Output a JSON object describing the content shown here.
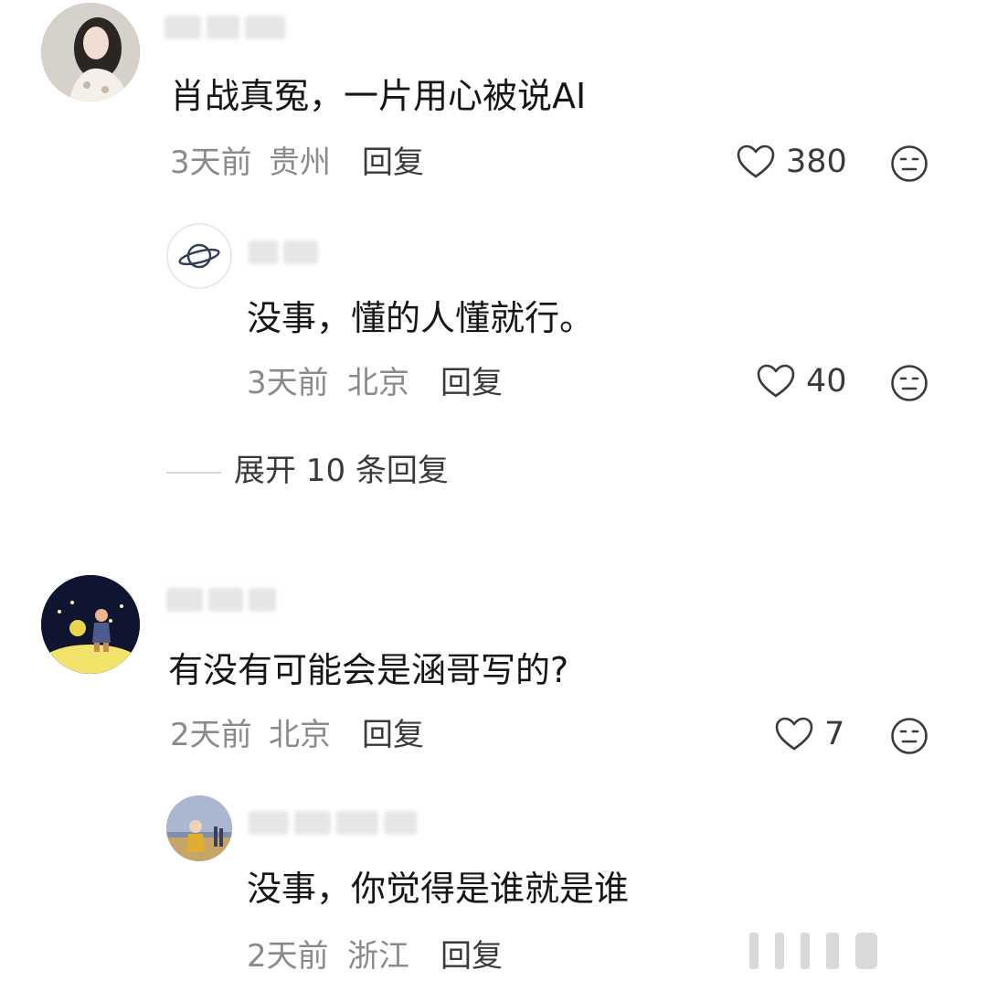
{
  "comments": [
    {
      "text": "肖战真冤，一片用心被说AI",
      "time": "3天前",
      "location": "贵州",
      "reply_label": "回复",
      "likes": "380",
      "reply": {
        "text": "没事，懂的人懂就行。",
        "time": "3天前",
        "location": "北京",
        "reply_label": "回复",
        "likes": "40"
      },
      "expand_label": "展开 10 条回复"
    },
    {
      "text": "有没有可能会是涵哥写的?",
      "time": "2天前",
      "location": "北京",
      "reply_label": "回复",
      "likes": "7",
      "reply": {
        "text": "没事，你觉得是谁就是谁",
        "time": "2天前",
        "location": "浙江",
        "reply_label": "回复"
      }
    }
  ],
  "icons": {
    "like": "heart-outline-icon",
    "dislike": "neutral-face-icon"
  },
  "colors": {
    "text": "#161616",
    "meta": "#8a8a8a",
    "action": "#3a3a3a"
  }
}
